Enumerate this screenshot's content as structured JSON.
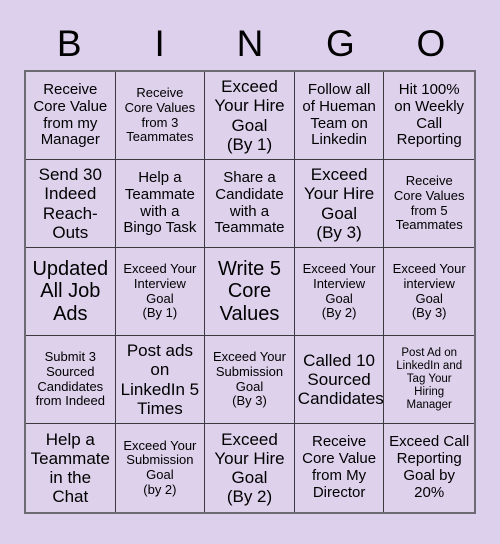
{
  "card": {
    "title": "BINGO",
    "header_letters": [
      "B",
      "I",
      "N",
      "G",
      "O"
    ],
    "colors": {
      "background": "#ddd0ec",
      "cell_background": "#ddd1ec",
      "grid_line": "#3c3a40",
      "outer_border": "#6e6a74",
      "text": "#000000"
    },
    "grid_size": "5x5",
    "cells": [
      {
        "text": "Receive\nCore Value\nfrom my\nManager",
        "size": "md"
      },
      {
        "text": "Receive\nCore Values\nfrom 3\nTeammates",
        "size": "sm"
      },
      {
        "text": "Exceed\nYour Hire\nGoal\n(By 1)",
        "size": "lg"
      },
      {
        "text": "Follow all\nof Hueman\nTeam on\nLinkedin",
        "size": "md"
      },
      {
        "text": "Hit 100%\non Weekly\nCall\nReporting",
        "size": "md"
      },
      {
        "text": "Send 30\nIndeed\nReach-\nOuts",
        "size": "lg"
      },
      {
        "text": "Help a\nTeammate\nwith a\nBingo Task",
        "size": "md"
      },
      {
        "text": "Share a\nCandidate\nwith a\nTeammate",
        "size": "md"
      },
      {
        "text": "Exceed\nYour Hire\nGoal\n(By 3)",
        "size": "lg"
      },
      {
        "text": "Receive\nCore Values\nfrom 5\nTeammates",
        "size": "sm"
      },
      {
        "text": "Updated\nAll Job\nAds",
        "size": "xl"
      },
      {
        "text": "Exceed Your\nInterview\nGoal\n(By 1)",
        "size": "sm"
      },
      {
        "text": "Write 5\nCore\nValues",
        "size": "xl"
      },
      {
        "text": "Exceed Your\nInterview\nGoal\n(By 2)",
        "size": "sm"
      },
      {
        "text": "Exceed Your\ninterview\nGoal\n(By 3)",
        "size": "sm"
      },
      {
        "text": "Submit 3\nSourced\nCandidates\nfrom Indeed",
        "size": "sm"
      },
      {
        "text": "Post ads\non\nLinkedIn 5\nTimes",
        "size": "lg"
      },
      {
        "text": "Exceed Your\nSubmission\nGoal\n(By 3)",
        "size": "sm"
      },
      {
        "text": "Called 10\nSourced\nCandidates",
        "size": "lg"
      },
      {
        "text": "Post Ad on\nLinkedIn and\nTag Your\nHiring\nManager",
        "size": "xs"
      },
      {
        "text": "Help a\nTeammate\nin the\nChat",
        "size": "lg"
      },
      {
        "text": "Exceed Your\nSubmission\nGoal\n(by 2)",
        "size": "sm"
      },
      {
        "text": "Exceed\nYour Hire\nGoal\n(By 2)",
        "size": "lg"
      },
      {
        "text": "Receive\nCore Value\nfrom My\nDirector",
        "size": "md"
      },
      {
        "text": "Exceed Call\nReporting\nGoal by\n20%",
        "size": "md"
      }
    ]
  }
}
